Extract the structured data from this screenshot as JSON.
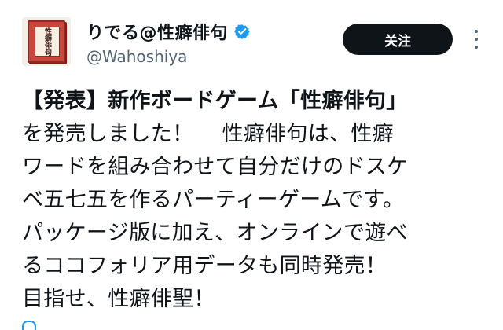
{
  "account": {
    "display_name": "りでる@性癖俳句",
    "handle": "@Wahoshiya",
    "avatar_label": "性癖俳句"
  },
  "actions": {
    "follow_label": "关注"
  },
  "icons": {
    "verified": "verified-badge-icon",
    "more": "more-options-icon"
  },
  "colors": {
    "verified_blue": "#1d9bf0",
    "follow_button": "#0f1419",
    "handle_gray": "#536471"
  },
  "tweet": {
    "lines": [
      "【発表】新作ボードゲーム「性癖俳句」",
      "を発売しました！　 性癖俳句は、性癖",
      "ワードを組み合わせて自分だけのドスケ",
      "ベ五七五を作るパーティーゲームです。",
      "パッケージ版に加え、オンラインで遊べ",
      "るココフォリア用データも同時発売！",
      "目指せ、性癖俳聖！"
    ]
  }
}
